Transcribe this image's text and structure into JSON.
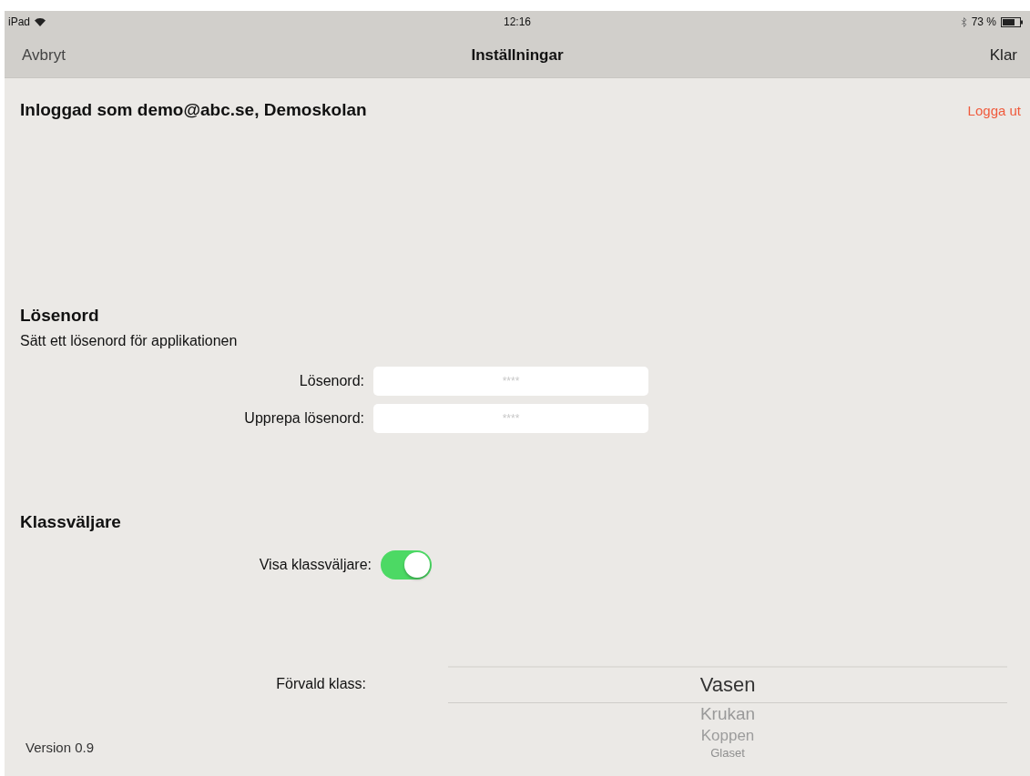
{
  "status_bar": {
    "device": "iPad",
    "time": "12:16",
    "battery": "73 %"
  },
  "nav_bar": {
    "left": "Avbryt",
    "title": "Inställningar",
    "right": "Klar"
  },
  "account": {
    "text": "Inloggad som demo@abc.se, Demoskolan",
    "logout": "Logga ut"
  },
  "password_section": {
    "title": "Lösenord",
    "subtitle": "Sätt ett lösenord för applikationen",
    "fields": [
      {
        "label": "Lösenord:",
        "placeholder": "****"
      },
      {
        "label": "Upprepa lösenord:",
        "placeholder": "****"
      }
    ]
  },
  "class_section": {
    "title": "Klassväljare",
    "toggle": {
      "label": "Visa klassväljare:",
      "on": true
    },
    "default_class": {
      "label": "Förvald klass:",
      "options": [
        {
          "label": "Vasen",
          "selected": true
        },
        {
          "label": "Krukan",
          "selected": false
        },
        {
          "label": "Koppen",
          "selected": false
        },
        {
          "label": "Glaset",
          "selected": false
        }
      ]
    }
  },
  "version": "Version 0.9"
}
